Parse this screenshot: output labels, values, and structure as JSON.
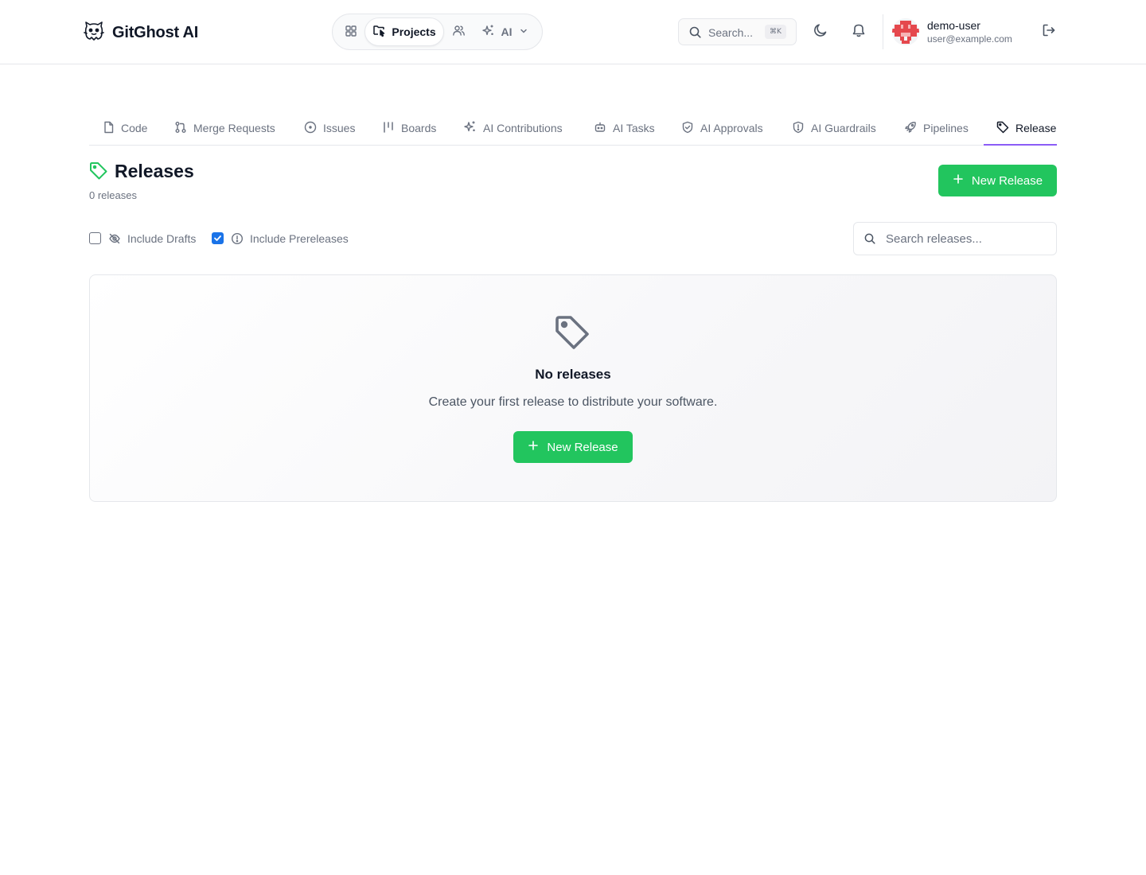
{
  "header": {
    "brand": "GitGhost AI",
    "nav": {
      "projects": "Projects",
      "ai": "AI"
    },
    "search": {
      "placeholder": "Search...",
      "shortcut": "⌘K"
    },
    "user": {
      "name": "demo-user",
      "email": "user@example.com"
    }
  },
  "tabs": [
    {
      "label": "Code",
      "icon": "file-icon"
    },
    {
      "label": "Merge Requests",
      "icon": "merge-icon"
    },
    {
      "label": "Issues",
      "icon": "issue-circle-icon"
    },
    {
      "label": "Boards",
      "icon": "kanban-icon"
    },
    {
      "label": "AI Contributions",
      "icon": "sparkles-icon"
    },
    {
      "label": "AI Tasks",
      "icon": "bot-icon"
    },
    {
      "label": "AI Approvals",
      "icon": "shield-check-icon"
    },
    {
      "label": "AI Guardrails",
      "icon": "shield-alert-icon"
    },
    {
      "label": "Pipelines",
      "icon": "rocket-icon"
    },
    {
      "label": "Release",
      "icon": "tag-icon",
      "active": true
    }
  ],
  "page": {
    "title": "Releases",
    "count_text": "0 releases",
    "new_release_label": "New Release"
  },
  "filters": {
    "include_drafts": {
      "label": "Include Drafts",
      "checked": false
    },
    "include_prereleases": {
      "label": "Include Prereleases",
      "checked": true
    },
    "search_placeholder": "Search releases..."
  },
  "empty_state": {
    "title": "No releases",
    "description": "Create your first release to distribute your software.",
    "button_label": "New Release"
  },
  "colors": {
    "accent_green": "#22c55e",
    "tab_underline": "#8b5cf6",
    "checkbox_blue": "#1a73e8"
  }
}
